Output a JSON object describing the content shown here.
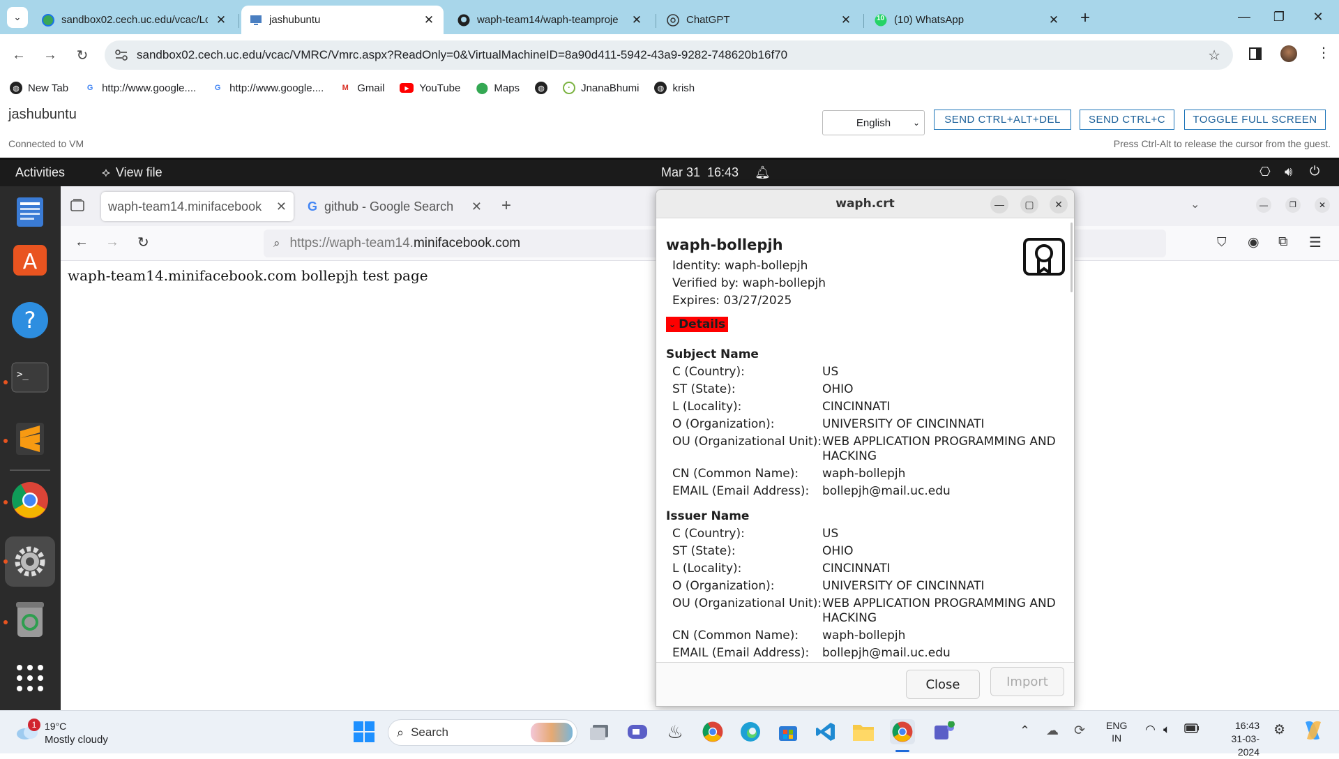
{
  "chrome": {
    "tabs": [
      {
        "title": "sandbox02.cech.uc.edu/vcac/Lo",
        "icon": "globe-icon",
        "active": false
      },
      {
        "title": "jashubuntu",
        "icon": "monitor-icon",
        "active": true
      },
      {
        "title": "waph-team14/waph-teamproje",
        "icon": "github-icon",
        "active": false
      },
      {
        "title": "ChatGPT",
        "icon": "chatgpt-icon",
        "active": false
      },
      {
        "title": "(10) WhatsApp",
        "icon": "whatsapp-icon",
        "active": false,
        "badge": "10"
      }
    ],
    "url": "sandbox02.cech.uc.edu/vcac/VMRC/Vmrc.aspx?ReadOnly=0&VirtualMachineID=8a90d411-5942-43a9-9282-748620b16f70",
    "bookmarks": [
      "New Tab",
      "http://www.google....",
      "http://www.google....",
      "Gmail",
      "YouTube",
      "Maps",
      "",
      "JnanaBhumi",
      "krish"
    ]
  },
  "vmrc": {
    "vm_name": "jashubuntu",
    "status": "Connected to VM",
    "language": "English",
    "btn_ctrl_alt_del": "SEND CTRL+ALT+DEL",
    "btn_ctrl_c": "SEND CTRL+C",
    "btn_fullscreen": "TOGGLE FULL SCREEN",
    "hint": "Press Ctrl-Alt to release the cursor from the guest."
  },
  "gnome": {
    "activities": "Activities",
    "app_menu": "View file",
    "clock": "Mar 31  16:43"
  },
  "firefox": {
    "tabs": [
      "waph-team14.minifacebook",
      "github - Google Search"
    ],
    "url_prefix": "https://waph-team14.",
    "url_domain": "minifacebook.com",
    "page_text": "waph-team14.minifacebook.com bollepjh test page"
  },
  "dialog": {
    "title": "waph.crt",
    "cert_name": "waph-bollepjh",
    "identity": "Identity: waph-bollepjh",
    "verified_by": "Verified by: waph-bollepjh",
    "expires": "Expires: 03/27/2025",
    "details": "Details",
    "subject_title": "Subject Name",
    "subject": [
      {
        "label": "C (Country):",
        "value": "US"
      },
      {
        "label": "ST (State):",
        "value": "OHIO"
      },
      {
        "label": "L (Locality):",
        "value": "CINCINNATI"
      },
      {
        "label": "O (Organization):",
        "value": "UNIVERSITY OF CINCINNATI"
      },
      {
        "label": "OU (Organizational Unit):",
        "value": "WEB APPLICATION PROGRAMMING AND HACKING"
      },
      {
        "label": "CN (Common Name):",
        "value": "waph-bollepjh"
      },
      {
        "label": "EMAIL (Email Address):",
        "value": "bollepjh@mail.uc.edu"
      }
    ],
    "issuer_title": "Issuer Name",
    "issuer": [
      {
        "label": "C (Country):",
        "value": "US"
      },
      {
        "label": "ST (State):",
        "value": "OHIO"
      },
      {
        "label": "L (Locality):",
        "value": "CINCINNATI"
      },
      {
        "label": "O (Organization):",
        "value": "UNIVERSITY OF CINCINNATI"
      },
      {
        "label": "OU (Organizational Unit):",
        "value": "WEB APPLICATION PROGRAMMING AND HACKING"
      },
      {
        "label": "CN (Common Name):",
        "value": "waph-bollepjh"
      },
      {
        "label": "EMAIL (Email Address):",
        "value": "bollepjh@mail.uc.edu"
      }
    ],
    "close_label": "Close",
    "import_label": "Import"
  },
  "taskbar": {
    "temperature": "19°C",
    "weather": "Mostly cloudy",
    "weather_badge": "1",
    "search": "Search",
    "lang_top": "ENG",
    "lang_bottom": "IN",
    "time": "16:43",
    "date": "31-03-2024"
  },
  "colors": {
    "details_highlight": "#ff0000",
    "chrome_tabstrip": "#a8d6ea",
    "ubuntu_orange": "#e95420"
  }
}
